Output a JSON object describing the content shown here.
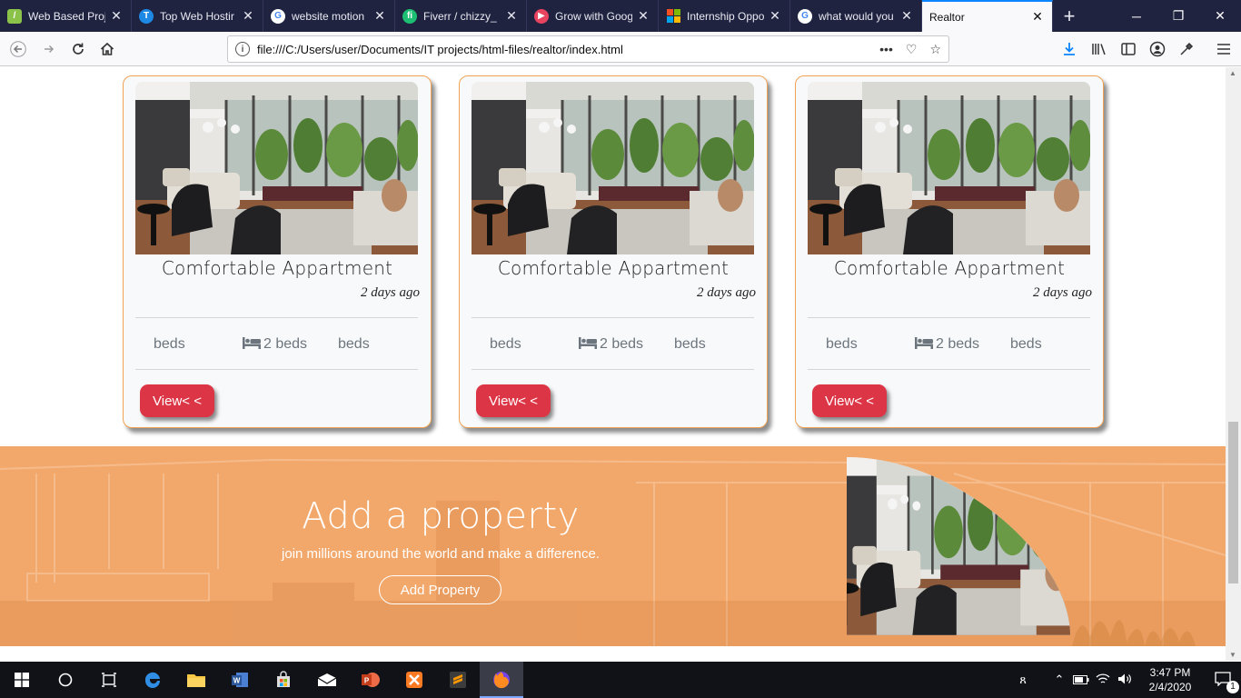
{
  "browser": {
    "tabs": [
      {
        "label": "Web Based Proj",
        "icon": "document-favicon-icon",
        "color": "#8bc34a"
      },
      {
        "label": "Top Web Hostir",
        "icon": "t-favicon-icon",
        "color": "#1e88e5"
      },
      {
        "label": "website motion",
        "icon": "google-favicon-icon",
        "color": "#ffffff"
      },
      {
        "label": "Fiverr / chizzy_",
        "icon": "fiverr-favicon-icon",
        "color": "#1dbf73"
      },
      {
        "label": "Grow with Goog",
        "icon": "play-favicon-icon",
        "color": "#e8435f"
      },
      {
        "label": "Internship Oppo",
        "icon": "microsoft-favicon-icon",
        "color": "#f25022"
      },
      {
        "label": "what would you",
        "icon": "google-favicon-icon",
        "color": "#ffffff"
      },
      {
        "label": "Realtor",
        "icon": "none",
        "color": "#f9f9fb"
      }
    ],
    "url": "file:///C:/Users/user/Documents/IT projects/html-files/realtor/index.html",
    "accent": "#0a84ff"
  },
  "cards": [
    {
      "title": "Comfortable Appartment",
      "time": "2 days ago",
      "feature_left": "beds",
      "feature_mid": "2 beds",
      "feature_right": "beds",
      "button": "View< <"
    },
    {
      "title": "Comfortable Appartment",
      "time": "2 days ago",
      "feature_left": "beds",
      "feature_mid": "2 beds",
      "feature_right": "beds",
      "button": "View< <"
    },
    {
      "title": "Comfortable Appartment",
      "time": "2 days ago",
      "feature_left": "beds",
      "feature_mid": "2 beds",
      "feature_right": "beds",
      "button": "View< <"
    }
  ],
  "banner": {
    "title": "Add a property",
    "subtitle": "join millions around the world and make a difference.",
    "button": "Add Property",
    "color": "#f2a66a"
  },
  "colors": {
    "card_border": "#f0a352",
    "button_red": "#dc3545"
  },
  "taskbar": {
    "time": "3:47 PM",
    "date": "2/4/2020",
    "notification_count": "1"
  }
}
